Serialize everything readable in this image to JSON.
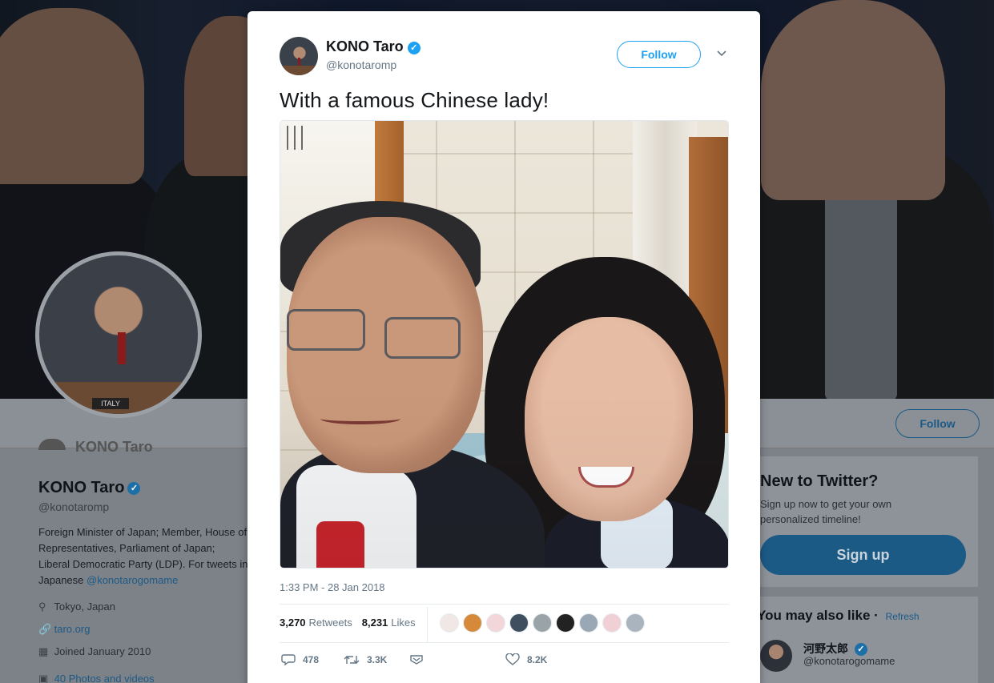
{
  "background": {
    "avatar_plate": "ITALY",
    "ghost_name": "KONO Taro",
    "follow_label": "Follow",
    "profile": {
      "name": "KONO Taro",
      "handle": "@konotaromp",
      "bio_text": "Foreign Minister of Japan; Member, House of Representatives, Parliament of Japan; Liberal Democratic Party (LDP). For tweets in Japanese ",
      "bio_link": "@konotarogomame",
      "location": "Tokyo, Japan",
      "website": "taro.org",
      "joined": "Joined January 2010",
      "photos": "40 Photos and videos"
    },
    "new_to_twitter": {
      "title": "New to Twitter?",
      "text": "Sign up now to get your own personalized timeline!",
      "signup_label": "Sign up"
    },
    "you_may_also_like": {
      "title": "You may also like",
      "refresh": "Refresh",
      "suggestion_name": "河野太郎",
      "suggestion_handle": "@konotarogomame"
    }
  },
  "tweet": {
    "name": "KONO Taro",
    "handle": "@konotaromp",
    "follow_label": "Follow",
    "text": "With a famous Chinese lady!",
    "timestamp": "1:33 PM - 28 Jan 2018",
    "retweets_count": "3,270",
    "retweets_label": "Retweets",
    "likes_count": "8,231",
    "likes_label": "Likes",
    "liker_colors": [
      "#f1e7e4",
      "#d7893a",
      "#f3d6da",
      "#3f4f5f",
      "#9aa4a8",
      "#222222",
      "#9aa7b4",
      "#f0d0d4",
      "#aab4bf"
    ],
    "actions": {
      "reply_count": "478",
      "retweet_count": "3.3K",
      "like_count": "8.2K"
    },
    "icons": {
      "verified": "verified-badge-icon",
      "caret": "chevron-down-icon",
      "reply": "reply-icon",
      "retweet": "retweet-icon",
      "dm": "direct-message-icon",
      "like": "heart-icon"
    },
    "accent_color": "#1da1f2"
  }
}
